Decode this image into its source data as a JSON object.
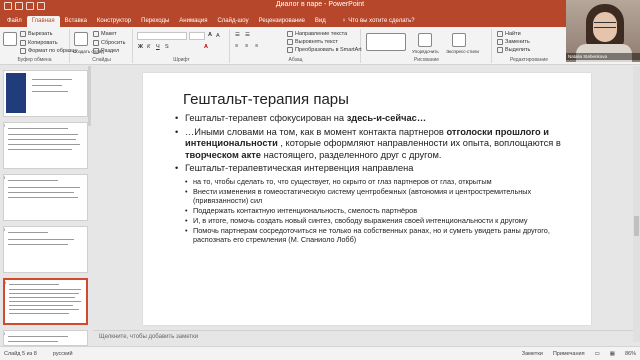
{
  "window": {
    "title": "Диалог в паре  -  PowerPoint"
  },
  "ribbon": {
    "tabs": [
      "Файл",
      "Главная",
      "Вставка",
      "Конструктор",
      "Переходы",
      "Анимация",
      "Слайд-шоу",
      "Рецензирование",
      "Вид"
    ],
    "active_tab": "Главная",
    "tell_me": "Что вы хотите сделать?",
    "clipboard": {
      "cut": "Вырезать",
      "copy": "Копировать",
      "format_painter": "Формат по образцу",
      "label": "Буфер обмена"
    },
    "slides": {
      "new_slide": "Создать слайд",
      "layout": "Макет",
      "reset": "Сбросить",
      "section": "Раздел",
      "label": "Слайды"
    },
    "font": {
      "label": "Шрифт"
    },
    "paragraph": {
      "text_direction": "Направление текста",
      "align_text": "Выровнять текст",
      "convert_smartart": "Преобразовать в SmartArt",
      "label": "Абзац"
    },
    "drawing": {
      "arrange": "Упорядочить",
      "quick_styles": "Экспресс-стили",
      "label": "Рисование"
    },
    "editing": {
      "find": "Найти",
      "replace": "Заменить",
      "select": "Выделить",
      "label": "Редактирование"
    }
  },
  "slide": {
    "title": "Гештальт-терапия пары",
    "bullet1": {
      "pre": "Гештальт-терапевт сфокусирован на ",
      "bold": "здесь-и-сейчас…"
    },
    "bullet2": {
      "pre": "…Иными словами на том, как в момент контакта партнеров ",
      "bold1": "отголоски прошлого и интенциональности",
      "mid": " , которые оформляют направленности их опыта, воплощаются в ",
      "bold2": "творческом акте",
      "post": " настоящего, разделенного друг с другом."
    },
    "bullet3": "Гештальт-терапевтическая интервенция направлена",
    "sub": [
      "на то, чтобы сделать то, что существует, но скрыто от глаз партнеров от глаз, открытым",
      "Внести изменения в гомеостатическую систему центробежных (автономия и центростремительных (привязанности) сил",
      "Поддержать контактную интенциональность, смелость партнёров",
      "И, в итоге, помочь создать новый синтез, свободу выражения своей интенциональности к другому",
      "Помочь партнерам сосредоточиться не только на собственных ранах, но и суметь увидеть раны другого, распознать его стремления (М. Спаниоло Лобб)"
    ]
  },
  "notes": {
    "placeholder": "Щелкните, чтобы добавить заметки"
  },
  "status": {
    "slide_info": "Слайд 5 из 8",
    "language": "русский",
    "notes": "Заметки",
    "comments": "Примечания",
    "zoom": "86%"
  },
  "thumbnails": {
    "numbers": [
      "2",
      "3",
      "4",
      "5",
      "6"
    ]
  },
  "webcam": {
    "name": "Natalia Stebenkova"
  },
  "colors": {
    "accent": "#b7472a",
    "selection": "#d04a2b"
  }
}
